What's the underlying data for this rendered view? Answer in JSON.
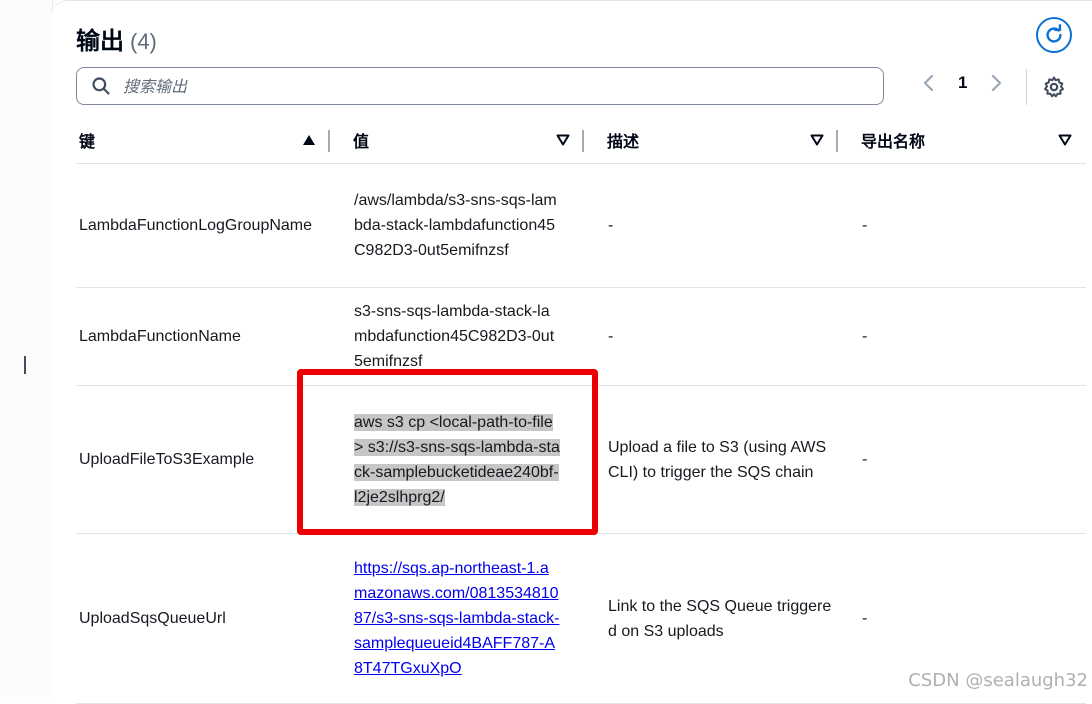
{
  "header": {
    "title": "输出",
    "count": "(4)"
  },
  "search": {
    "placeholder": "搜索输出",
    "value": ""
  },
  "pagination": {
    "page": "1"
  },
  "table": {
    "columns": [
      "键",
      "值",
      "描述",
      "导出名称"
    ],
    "rows": [
      {
        "key": "LambdaFunctionLogGroupName",
        "value": "/aws/lambda/s3-sns-sqs-lambda-stack-lambdafunction45C982D3-0ut5emifnzsf",
        "description": "-",
        "export": "-"
      },
      {
        "key": "LambdaFunctionName",
        "value": "s3-sns-sqs-lambda-stack-lambdafunction45C982D3-0ut5emifnzsf",
        "description": "-",
        "export": "-"
      },
      {
        "key": "UploadFileToS3Example",
        "value": "aws s3 cp <local-path-to-file> s3://s3-sns-sqs-lambda-stack-samplebucketideae240bf-l2je2slhprg2/",
        "description": "Upload a file to S3 (using AWS CLI) to trigger the SQS chain",
        "export": "-"
      },
      {
        "key": "UploadSqsQueueUrl",
        "value": "https://sqs.ap-northeast-1.amazonaws.com/081353481087/s3-sns-sqs-lambda-stack-samplequeueid4BAFF787-A8T47TGxuXpO",
        "description": "Link to the SQS Queue triggered on S3 uploads",
        "export": "-"
      }
    ]
  },
  "watermark": "CSDN @sealaugh32",
  "colors": {
    "accent": "#0972d3",
    "highlight_border": "#ec0000",
    "link": "#0000ee"
  }
}
